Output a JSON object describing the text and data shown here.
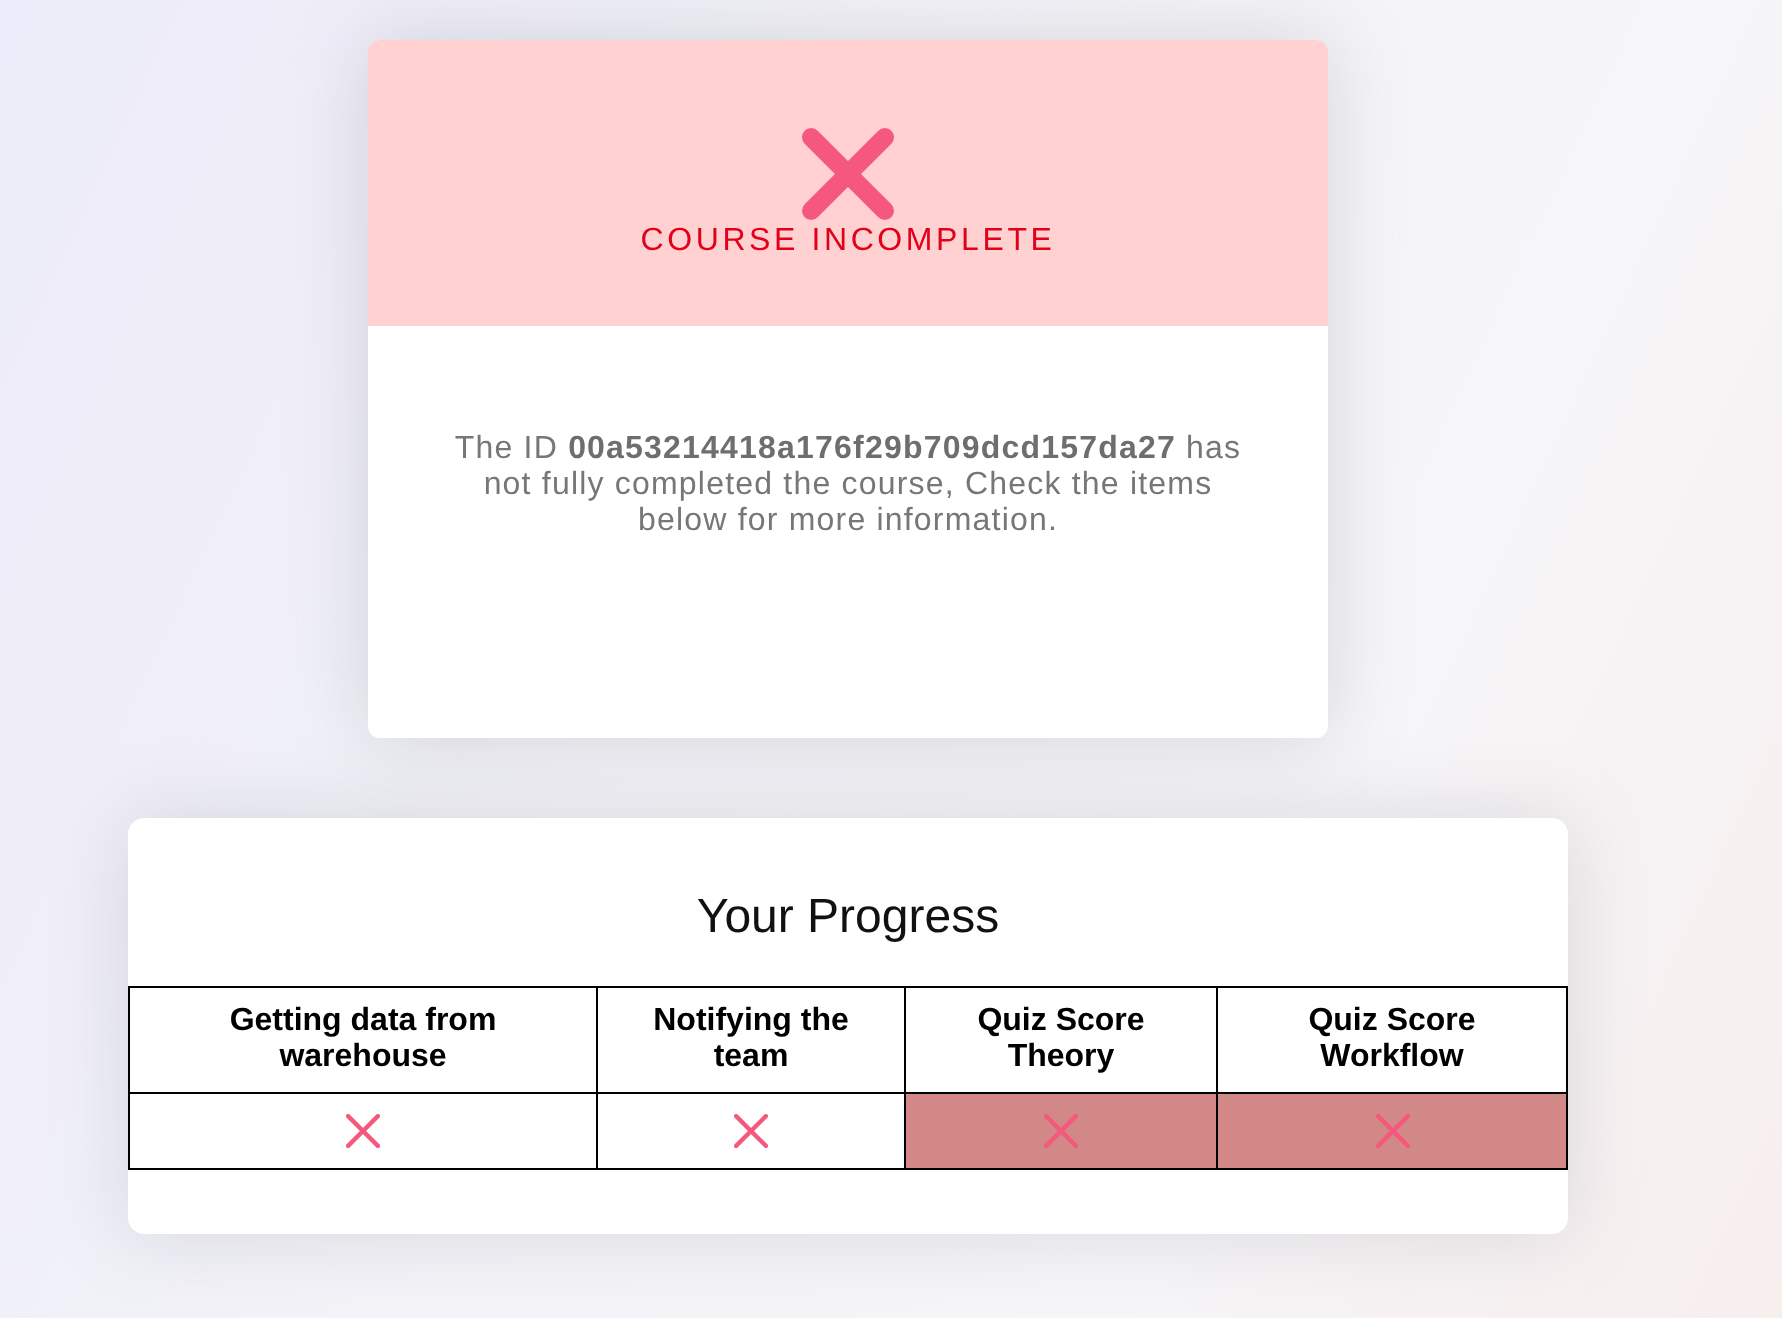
{
  "result": {
    "passed": false,
    "title": "COURSE INCOMPLETE",
    "message": "The ID **00a53214418a176f29b709dcd157da27** has not fully completed the course, Check the items below for more information."
  },
  "progress": {
    "title": "Your Progress",
    "table": {
      "columns": [
        "Getting data from warehouse",
        "Notifying the team",
        "Quiz Score Theory",
        "Quiz Score Workflow"
      ],
      "rows": [
        {
          "cells": [
            {
              "passed": false,
              "highlighted": false
            },
            {
              "passed": false,
              "highlighted": false
            },
            {
              "passed": false,
              "highlighted": true
            },
            {
              "passed": false,
              "highlighted": true
            }
          ]
        }
      ]
    }
  }
}
